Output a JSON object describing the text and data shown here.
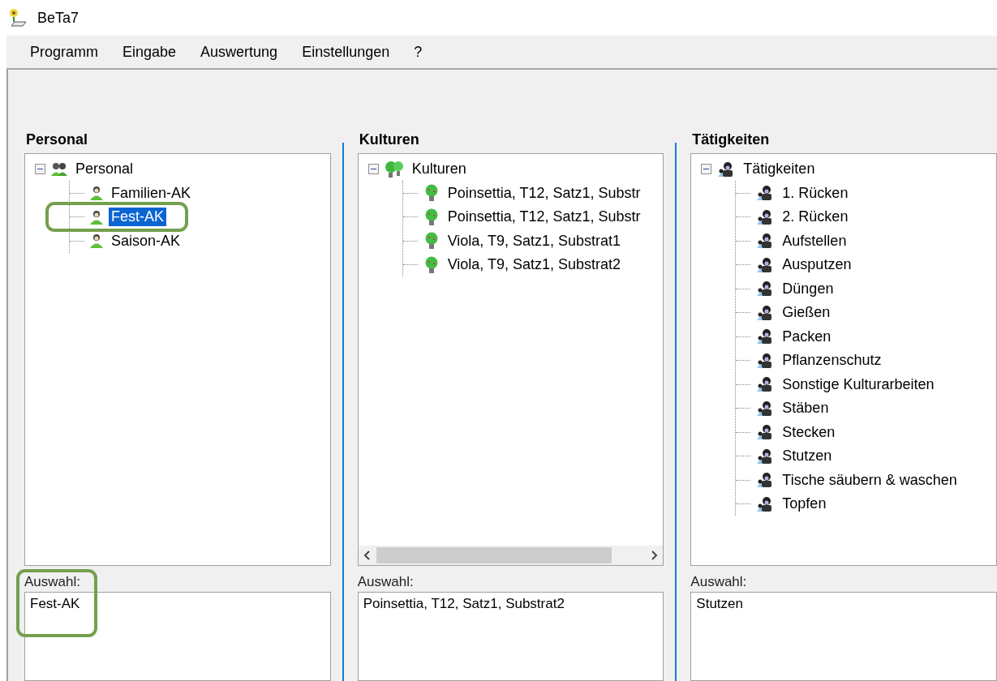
{
  "window": {
    "title": "BeTa7"
  },
  "menu": [
    {
      "label": "Programm"
    },
    {
      "label": "Eingabe"
    },
    {
      "label": "Auswertung"
    },
    {
      "label": "Einstellungen"
    },
    {
      "label": "?"
    }
  ],
  "panels": [
    {
      "kind": "personnel",
      "heading": "Personal",
      "horizontal_scrollbar": false,
      "tree": {
        "label": "Personal",
        "expanded": true,
        "selected": false,
        "children": [
          {
            "label": "Familien-AK",
            "selected": false,
            "highlighted": false
          },
          {
            "label": "Fest-AK",
            "selected": true,
            "highlighted": true
          },
          {
            "label": "Saison-AK",
            "selected": false,
            "highlighted": false
          }
        ]
      },
      "selection_label": "Auswahl:",
      "selection_value": "Fest-AK",
      "highlighted": true
    },
    {
      "kind": "crops",
      "heading": "Kulturen",
      "horizontal_scrollbar": true,
      "tree": {
        "label": "Kulturen",
        "expanded": true,
        "selected": false,
        "children": [
          {
            "label": "Poinsettia, T12, Satz1, Substr",
            "selected": false,
            "highlighted": false
          },
          {
            "label": "Poinsettia, T12, Satz1, Substr",
            "selected": false,
            "highlighted": false
          },
          {
            "label": "Viola, T9, Satz1, Substrat1",
            "selected": false,
            "highlighted": false
          },
          {
            "label": "Viola, T9, Satz1, Substrat2",
            "selected": false,
            "highlighted": false
          }
        ]
      },
      "selection_label": "Auswahl:",
      "selection_value": "Poinsettia, T12, Satz1, Substrat2",
      "highlighted": false
    },
    {
      "kind": "activities",
      "heading": "Tätigkeiten",
      "horizontal_scrollbar": false,
      "tree": {
        "label": "Tätigkeiten",
        "expanded": true,
        "selected": false,
        "children": [
          {
            "label": "1. Rücken",
            "selected": false,
            "highlighted": false
          },
          {
            "label": "2. Rücken",
            "selected": false,
            "highlighted": false
          },
          {
            "label": "Aufstellen",
            "selected": false,
            "highlighted": false
          },
          {
            "label": "Ausputzen",
            "selected": false,
            "highlighted": false
          },
          {
            "label": "Düngen",
            "selected": false,
            "highlighted": false
          },
          {
            "label": "Gießen",
            "selected": false,
            "highlighted": false
          },
          {
            "label": "Packen",
            "selected": false,
            "highlighted": false
          },
          {
            "label": "Pflanzenschutz",
            "selected": false,
            "highlighted": false
          },
          {
            "label": "Sonstige Kulturarbeiten",
            "selected": false,
            "highlighted": false
          },
          {
            "label": "Stäben",
            "selected": false,
            "highlighted": false
          },
          {
            "label": "Stecken",
            "selected": false,
            "highlighted": false
          },
          {
            "label": "Stutzen",
            "selected": false,
            "highlighted": false
          },
          {
            "label": "Tische säubern & waschen",
            "selected": false,
            "highlighted": false
          },
          {
            "label": "Topfen",
            "selected": false,
            "highlighted": false
          }
        ]
      },
      "selection_label": "Auswahl:",
      "selection_value": "Stutzen",
      "highlighted": false
    }
  ]
}
